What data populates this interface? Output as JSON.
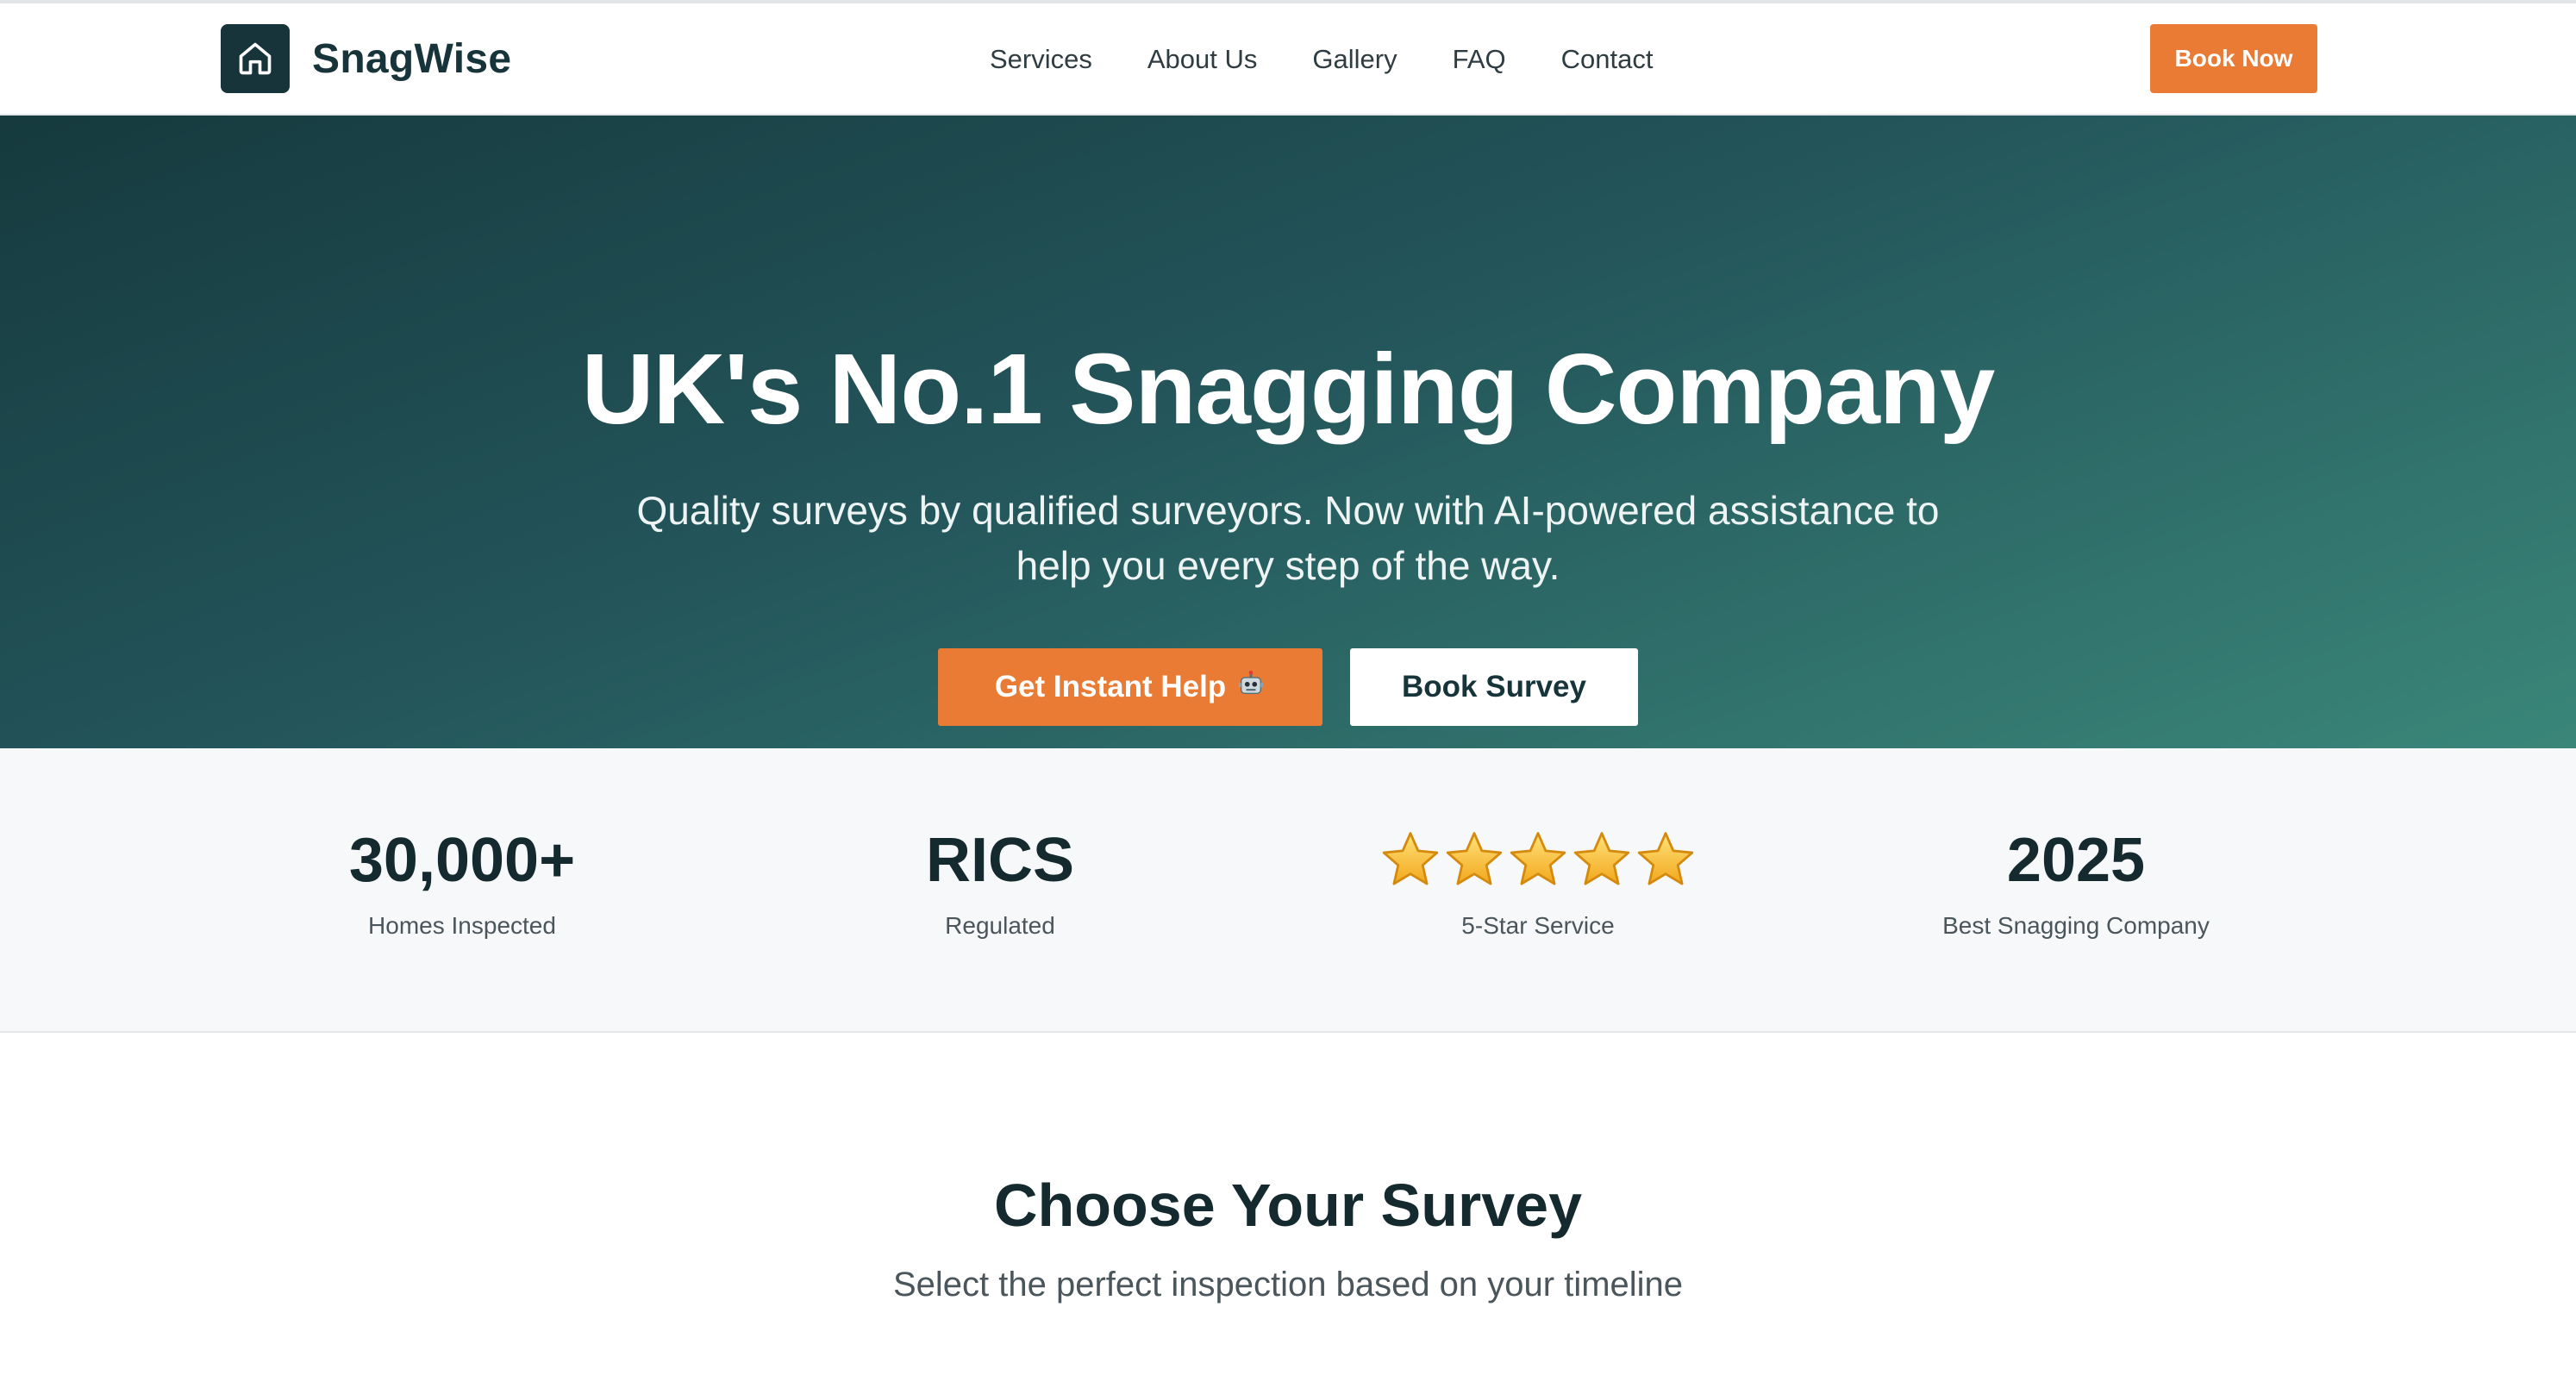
{
  "brand": {
    "name": "SnagWise",
    "logo_icon": "home-icon"
  },
  "nav": {
    "links": [
      "Services",
      "About Us",
      "Gallery",
      "FAQ",
      "Contact"
    ],
    "cta_label": "Book Now"
  },
  "hero": {
    "title": "UK's No.1 Snagging Company",
    "subtitle_line1": "Quality surveys by qualified surveyors. Now with AI-powered assistance to",
    "subtitle_line2": "help you every step of the way.",
    "primary_button": "Get Instant Help",
    "primary_button_icon": "robot-icon",
    "secondary_button": "Book Survey"
  },
  "stats": [
    {
      "value": "30,000+",
      "label": "Homes Inspected"
    },
    {
      "value": "RICS",
      "label": "Regulated"
    },
    {
      "value": "5",
      "label": "5-Star Service",
      "icon": "star-icon"
    },
    {
      "value": "2025",
      "label": "Best Snagging Company"
    }
  ],
  "choose": {
    "title": "Choose Your Survey",
    "subtitle": "Select the perfect inspection based on your timeline"
  },
  "colors": {
    "accent": "#e97b35",
    "brand_dark": "#17343a",
    "hero_start": "#163a3e",
    "hero_end": "#3a8679"
  }
}
